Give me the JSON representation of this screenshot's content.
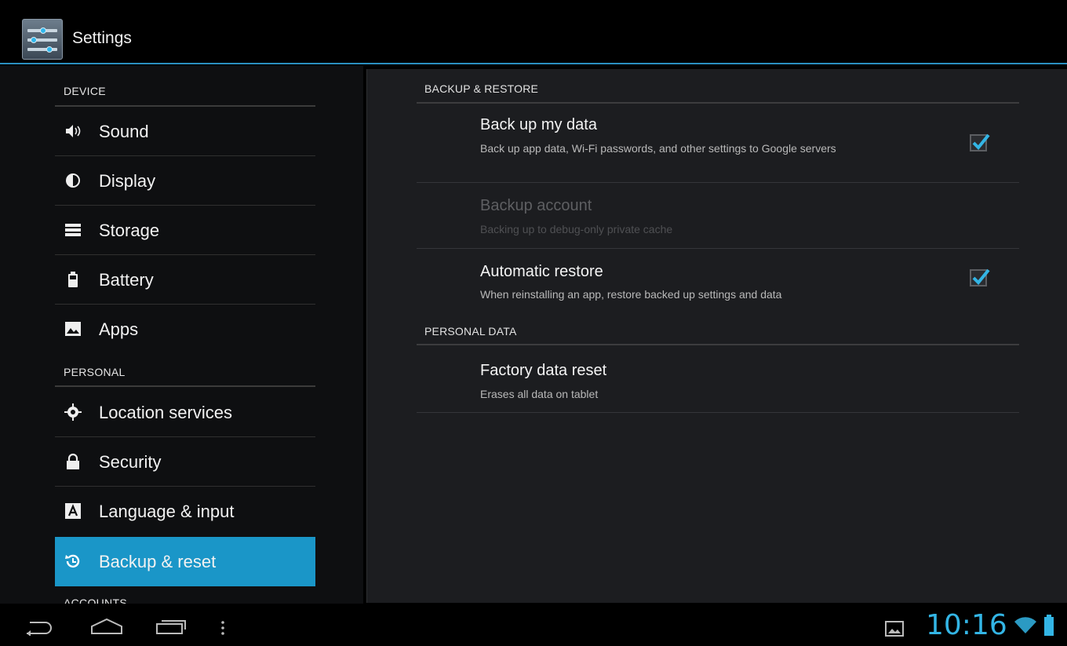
{
  "app": {
    "title": "Settings"
  },
  "sidebar": {
    "sections": [
      {
        "heading": "DEVICE"
      },
      {
        "heading": "PERSONAL"
      },
      {
        "heading": "ACCOUNTS"
      }
    ],
    "items": [
      {
        "label": "Sound",
        "icon": "sound-icon"
      },
      {
        "label": "Display",
        "icon": "display-icon"
      },
      {
        "label": "Storage",
        "icon": "storage-icon"
      },
      {
        "label": "Battery",
        "icon": "battery-icon"
      },
      {
        "label": "Apps",
        "icon": "apps-icon"
      },
      {
        "label": "Location services",
        "icon": "location-icon"
      },
      {
        "label": "Security",
        "icon": "lock-icon"
      },
      {
        "label": "Language & input",
        "icon": "language-icon"
      },
      {
        "label": "Backup & reset",
        "icon": "backup-icon",
        "selected": true
      }
    ]
  },
  "main": {
    "backup_heading": "BACKUP & RESTORE",
    "personal_heading": "PERSONAL DATA",
    "prefs": [
      {
        "title": "Back up my data",
        "summary": "Back up app data, Wi-Fi passwords, and other settings to Google servers",
        "checked": true
      },
      {
        "title": "Backup account",
        "summary": "Backing up to debug-only private cache",
        "enabled": false
      },
      {
        "title": "Automatic restore",
        "summary": "When reinstalling an app, restore backed up settings and data",
        "checked": true
      },
      {
        "title": "Factory data reset",
        "summary": "Erases all data on tablet"
      }
    ]
  },
  "status_bar": {
    "time": "10:16"
  },
  "colors": {
    "accent": "#33b5e5",
    "selected": "#1a96c8"
  }
}
